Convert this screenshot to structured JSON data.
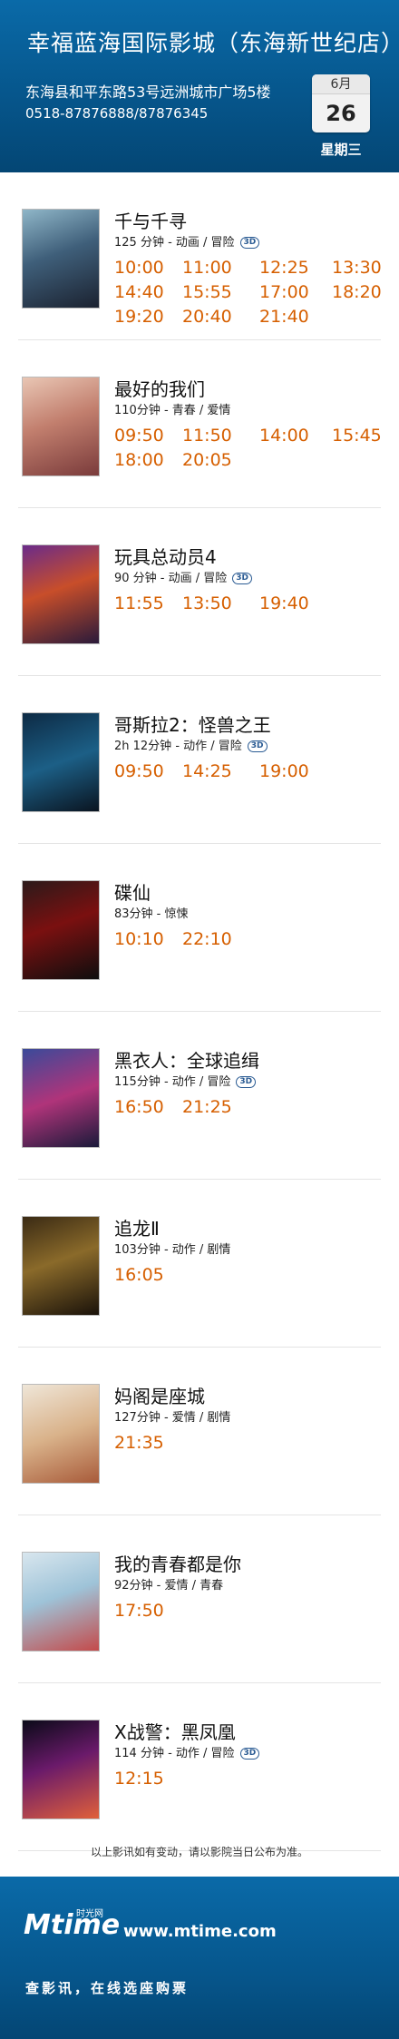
{
  "header": {
    "title": "幸福蓝海国际影城（东海新世纪店）",
    "address": "东海县和平东路53号远洲城市广场5楼",
    "phone": "0518-87876888/87876345",
    "calendar": {
      "month": "6月",
      "day": "26",
      "weekday": "星期三"
    }
  },
  "badge_3d": "3D",
  "movies": [
    {
      "title": "千与千寻",
      "meta": "125 分钟 - 动画 / 冒险",
      "is3d": true,
      "times": [
        "10:00",
        "11:00",
        "12:25",
        "13:30",
        "14:40",
        "15:55",
        "17:00",
        "18:20",
        "19:20",
        "20:40",
        "21:40"
      ]
    },
    {
      "title": "最好的我们",
      "meta": "110分钟 - 青春 / 爱情",
      "is3d": false,
      "times": [
        "09:50",
        "11:50",
        "14:00",
        "15:45",
        "18:00",
        "20:05"
      ]
    },
    {
      "title": "玩具总动员4",
      "meta": "90 分钟 - 动画 / 冒险",
      "is3d": true,
      "times": [
        "11:55",
        "13:50",
        "19:40"
      ]
    },
    {
      "title": "哥斯拉2：怪兽之王",
      "meta": "2h 12分钟 - 动作 / 冒险",
      "is3d": true,
      "times": [
        "09:50",
        "14:25",
        "19:00"
      ]
    },
    {
      "title": "碟仙",
      "meta": "83分钟 - 惊悚",
      "is3d": false,
      "times": [
        "10:10",
        "22:10"
      ]
    },
    {
      "title": "黑衣人：全球追缉",
      "meta": "115分钟 - 动作 / 冒险",
      "is3d": true,
      "times": [
        "16:50",
        "21:25"
      ]
    },
    {
      "title": "追龙Ⅱ",
      "meta": "103分钟 - 动作 / 剧情",
      "is3d": false,
      "times": [
        "16:05"
      ]
    },
    {
      "title": "妈阁是座城",
      "meta": "127分钟 - 爱情 / 剧情",
      "is3d": false,
      "times": [
        "21:35"
      ]
    },
    {
      "title": "我的青春都是你",
      "meta": "92分钟 - 爱情 / 青春",
      "is3d": false,
      "times": [
        "17:50"
      ]
    },
    {
      "title": "X战警：黑凤凰",
      "meta": "114 分钟 - 动作 / 冒险",
      "is3d": true,
      "times": [
        "12:15"
      ]
    }
  ],
  "footer": {
    "note": "以上影讯如有变动，请以影院当日公布为准。",
    "logo": "Mtime",
    "logo_sub": "时光网",
    "site": "www.mtime.com",
    "slogan": "查影讯，在线选座购票"
  },
  "colors": {
    "header_blue": "#06568c",
    "time_orange": "#d65f00",
    "badge_blue": "#2a5b93"
  }
}
